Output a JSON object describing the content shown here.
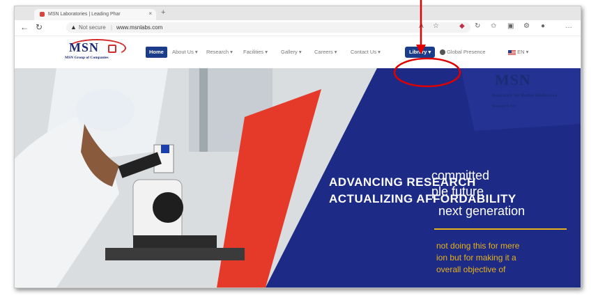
{
  "browser": {
    "tab_title": "MSN Laboratories | Leading Phar",
    "tab_close": "×",
    "new_tab": "+",
    "not_secure": "Not secure",
    "url": "www.msnlabs.com"
  },
  "site": {
    "logo_text": "MSN",
    "logo_subtitle": "MSN Group of Companies",
    "menu": {
      "home": "Home",
      "about": "About Us ▾",
      "research": "Research ▾",
      "facilities": "Facilities ▾",
      "gallery": "Gallery ▾",
      "careers": "Careers ▾",
      "contact": "Contact Us ▾",
      "library": "Library ▾",
      "global": "Global Presence",
      "lang": "EN ▾"
    }
  },
  "hero": {
    "line1": "ADVANCING RESEARCH",
    "line2": "ACTUALIZING AFFORDABILITY",
    "tag1": "committed",
    "tag2": "ple future",
    "tag3": "next generation",
    "para1": "not doing this for mere",
    "para2": "ion but for making it a",
    "para3": "overall objective of",
    "badge_logo": "MSN",
    "badge_tagline": "Research for Better Medicines",
    "badge_tagline2": "Research for"
  },
  "colors": {
    "nav_active": "#1a3c8a",
    "hero_navy": "#1a2470",
    "accent_red": "#e53a2a",
    "gold": "#e7b21d",
    "annotation_red": "#e00000"
  }
}
